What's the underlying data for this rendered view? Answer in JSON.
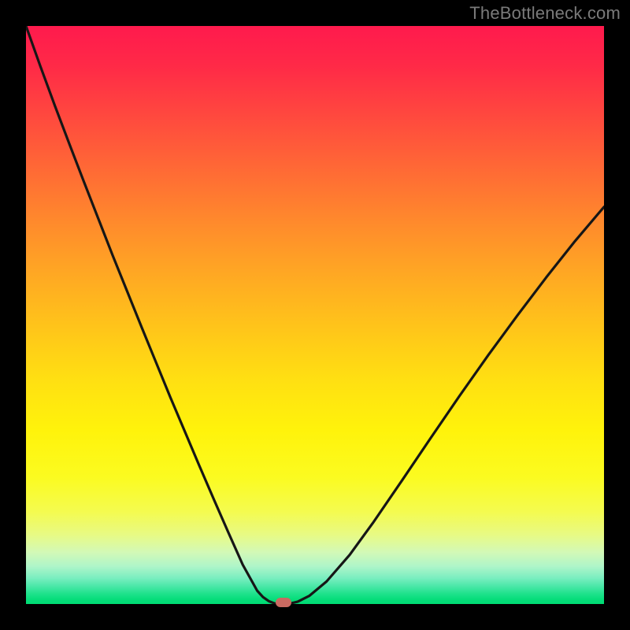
{
  "watermark": "TheBottleneck.com",
  "colors": {
    "frame": "#000000",
    "curve_stroke": "#161616",
    "marker_fill": "#c96a61"
  },
  "chart_data": {
    "type": "line",
    "title": "",
    "xlabel": "",
    "ylabel": "",
    "xlim": [
      0,
      1
    ],
    "ylim": [
      0,
      1
    ],
    "grid": false,
    "x": [
      0.0,
      0.025,
      0.05,
      0.075,
      0.1,
      0.125,
      0.15,
      0.175,
      0.2,
      0.225,
      0.25,
      0.275,
      0.3,
      0.325,
      0.35,
      0.375,
      0.4,
      0.41,
      0.42,
      0.43,
      0.44,
      0.446,
      0.453,
      0.47,
      0.49,
      0.52,
      0.56,
      0.6,
      0.65,
      0.7,
      0.75,
      0.8,
      0.85,
      0.9,
      0.95,
      1.0
    ],
    "values": [
      1.0,
      0.93,
      0.862,
      0.796,
      0.731,
      0.667,
      0.603,
      0.541,
      0.479,
      0.418,
      0.357,
      0.298,
      0.239,
      0.181,
      0.124,
      0.068,
      0.023,
      0.012,
      0.005,
      0.001,
      0.0,
      0.0,
      0.0,
      0.004,
      0.014,
      0.039,
      0.085,
      0.14,
      0.213,
      0.287,
      0.36,
      0.431,
      0.499,
      0.565,
      0.628,
      0.687
    ],
    "marker": {
      "x": 0.445,
      "y": 0.0
    },
    "background_gradient": "vertical red→orange→yellow→green"
  }
}
